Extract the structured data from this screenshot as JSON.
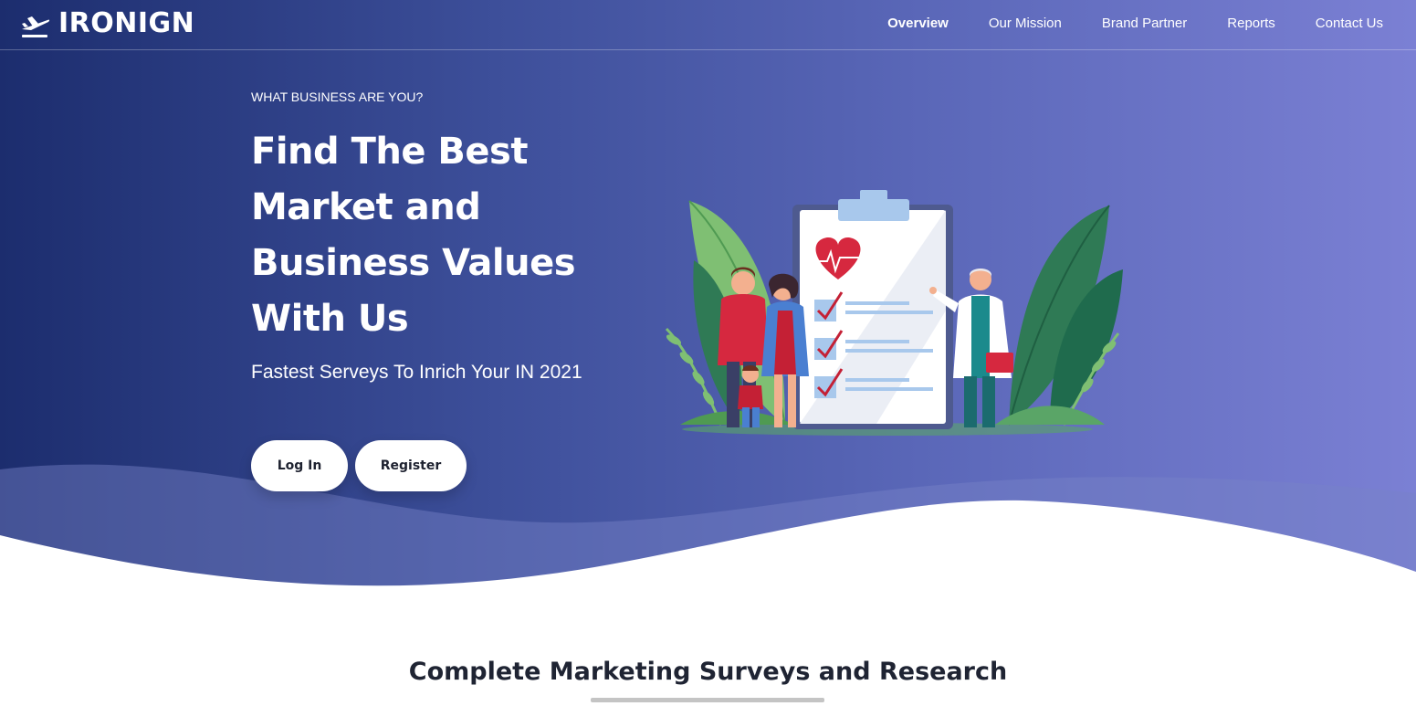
{
  "brand": {
    "name": "IRONIGN",
    "icon": "plane-departure-icon"
  },
  "nav": {
    "items": [
      {
        "label": "Overview",
        "active": true
      },
      {
        "label": "Our Mission",
        "active": false
      },
      {
        "label": "Brand Partner",
        "active": false
      },
      {
        "label": "Reports",
        "active": false
      },
      {
        "label": "Contact Us",
        "active": false
      }
    ]
  },
  "hero": {
    "eyebrow": "WHAT BUSINESS ARE YOU?",
    "headline": "Find The Best Market and Business Values With Us",
    "subheadline": "Fastest Serveys To Inrich Your IN 2021",
    "buttons": {
      "login": "Log In",
      "register": "Register"
    },
    "illustration": "family-doctor-health-checklist-illustration"
  },
  "section": {
    "title": "Complete Marketing Surveys and Research"
  },
  "colors": {
    "gradient_start": "#1c2d6e",
    "gradient_end": "#7b80d4",
    "text_on_hero": "#ffffff",
    "button_bg": "#ffffff",
    "heading_dark": "#1f2433"
  }
}
